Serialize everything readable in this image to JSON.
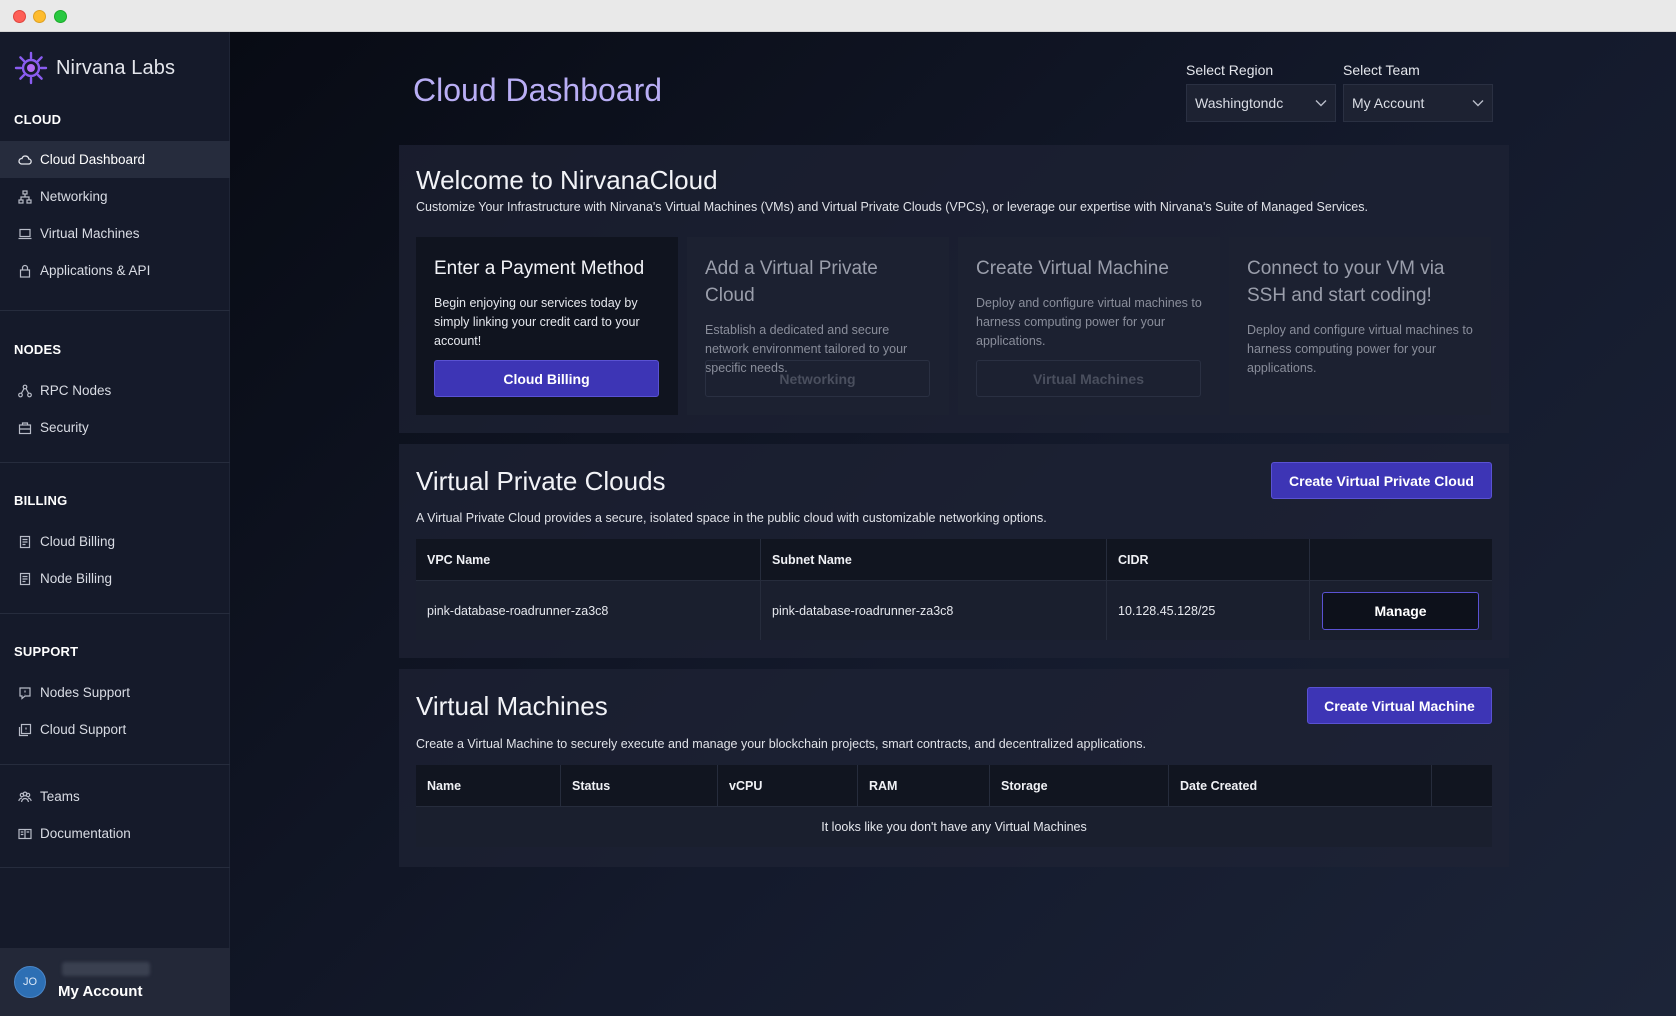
{
  "sidebar": {
    "brand": "Nirvana Labs",
    "sections": [
      {
        "heading": "CLOUD",
        "items": [
          {
            "label": "Cloud Dashboard",
            "icon": "cloud-icon"
          },
          {
            "label": "Networking",
            "icon": "network-icon"
          },
          {
            "label": "Virtual Machines",
            "icon": "laptop-icon"
          },
          {
            "label": "Applications & API",
            "icon": "lock-icon"
          }
        ]
      },
      {
        "heading": "NODES",
        "items": [
          {
            "label": "RPC Nodes",
            "icon": "nodes-icon"
          },
          {
            "label": "Security",
            "icon": "security-icon"
          }
        ]
      },
      {
        "heading": "BILLING",
        "items": [
          {
            "label": "Cloud Billing",
            "icon": "receipt-icon"
          },
          {
            "label": "Node Billing",
            "icon": "receipt-icon"
          }
        ]
      },
      {
        "heading": "SUPPORT",
        "items": [
          {
            "label": "Nodes Support",
            "icon": "support-icon"
          },
          {
            "label": "Cloud Support",
            "icon": "support-icon"
          }
        ]
      },
      {
        "heading": "",
        "items": [
          {
            "label": "Teams",
            "icon": "team-icon"
          },
          {
            "label": "Documentation",
            "icon": "book-icon"
          }
        ]
      }
    ],
    "account": {
      "initials": "JO",
      "name": "My Account"
    }
  },
  "header": {
    "title": "Cloud Dashboard",
    "region": {
      "label": "Select Region",
      "value": "Washingtondc"
    },
    "team": {
      "label": "Select Team",
      "value": "My Account"
    }
  },
  "welcome": {
    "title": "Welcome to NirvanaCloud",
    "description": "Customize Your Infrastructure with Nirvana's Virtual Machines (VMs) and Virtual Private Clouds (VPCs), or leverage our expertise with Nirvana's Suite of Managed Services.",
    "cards": [
      {
        "title": "Enter a Payment Method",
        "body": "Begin enjoying our services today by simply linking your credit card to your account!",
        "button": "Cloud Billing"
      },
      {
        "title": "Add a Virtual Private Cloud",
        "body": "Establish a dedicated and secure network environment tailored to your specific needs.",
        "button": "Networking"
      },
      {
        "title": "Create Virtual Machine",
        "body": "Deploy and configure virtual machines to harness computing power for your applications.",
        "button": "Virtual Machines"
      },
      {
        "title": "Connect to your VM via SSH and start coding!",
        "body": "Deploy and configure virtual machines to harness computing power for your applications."
      }
    ]
  },
  "vpc": {
    "title": "Virtual Private Clouds",
    "create_button": "Create Virtual Private Cloud",
    "description": "A Virtual Private Cloud provides a secure, isolated space in the public cloud with customizable networking options.",
    "columns": [
      "VPC Name",
      "Subnet Name",
      "CIDR",
      ""
    ],
    "rows": [
      {
        "vpc_name": "pink-database-roadrunner-za3c8",
        "subnet_name": "pink-database-roadrunner-za3c8",
        "cidr": "10.128.45.128/25",
        "action": "Manage"
      }
    ]
  },
  "vms": {
    "title": "Virtual Machines",
    "create_button": "Create Virtual Machine",
    "description": "Create a Virtual Machine to securely execute and manage your blockchain projects, smart contracts, and decentralized applications.",
    "columns": [
      "Name",
      "Status",
      "vCPU",
      "RAM",
      "Storage",
      "Date Created",
      ""
    ],
    "empty_message": "It looks like you don't have any Virtual Machines"
  },
  "colors": {
    "accent": "#3d35b5",
    "title_purple": "#b9aef5",
    "sidebar_bg": "#151a2a"
  }
}
